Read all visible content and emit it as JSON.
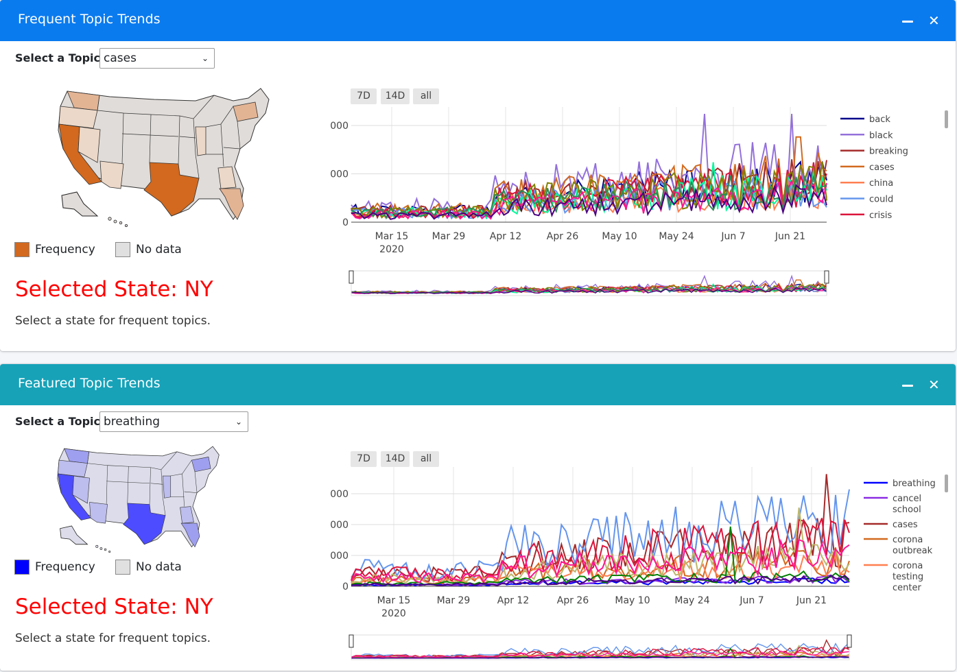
{
  "card1": {
    "title": "Frequent Topic Trends",
    "header_color": "#0a7bef",
    "select_label": "Select a Topic:",
    "selected_topic": "cases",
    "legend_frequency": "Frequency",
    "legend_nodata": "No data",
    "frequency_color": "#d2691e",
    "selected_state": "Selected State: NY",
    "hint": "Select a state for frequent topics.",
    "range_buttons": [
      "7D",
      "14D",
      "all"
    ]
  },
  "card2": {
    "title": "Featured Topic Trends",
    "header_color": "#17a2b8",
    "select_label": "Select a Topic:",
    "selected_topic": "breathing",
    "legend_frequency": "Frequency",
    "legend_nodata": "No data",
    "frequency_color": "#0000ff",
    "selected_state": "Selected State: NY",
    "hint": "Select a state for frequent topics.",
    "range_buttons": [
      "7D",
      "14D",
      "all"
    ]
  },
  "chart_data": [
    {
      "type": "line",
      "x_ticks": [
        "Mar 15",
        "Mar 29",
        "Apr 12",
        "Apr 26",
        "May 10",
        "May 24",
        "Jun 7",
        "Jun 21"
      ],
      "x_year_label": "2020",
      "y_ticks": [
        "0",
        "000",
        "000"
      ],
      "series": [
        {
          "name": "back",
          "color": "#00008b"
        },
        {
          "name": "black",
          "color": "#9370db"
        },
        {
          "name": "breaking",
          "color": "#a52a2a"
        },
        {
          "name": "cases",
          "color": "#d2691e"
        },
        {
          "name": "china",
          "color": "#ff7f50"
        },
        {
          "name": "could",
          "color": "#6495ed"
        },
        {
          "name": "crisis",
          "color": "#dc143c"
        }
      ],
      "legend_placement": "right",
      "range_slider": true,
      "grid": true
    },
    {
      "type": "line",
      "x_ticks": [
        "Mar 15",
        "Mar 29",
        "Apr 12",
        "Apr 26",
        "May 10",
        "May 24",
        "Jun 7",
        "Jun 21"
      ],
      "x_year_label": "2020",
      "y_ticks": [
        "0",
        "000",
        "000",
        "000"
      ],
      "series": [
        {
          "name": "breathing",
          "color": "#0000ff"
        },
        {
          "name": "cancel school",
          "color": "#8a2be2"
        },
        {
          "name": "cases",
          "color": "#a52a2a"
        },
        {
          "name": "corona outbreak",
          "color": "#d2691e"
        },
        {
          "name": "corona testing center",
          "color": "#ff7f50"
        }
      ],
      "legend_placement": "right",
      "range_slider": true,
      "grid": true
    }
  ]
}
